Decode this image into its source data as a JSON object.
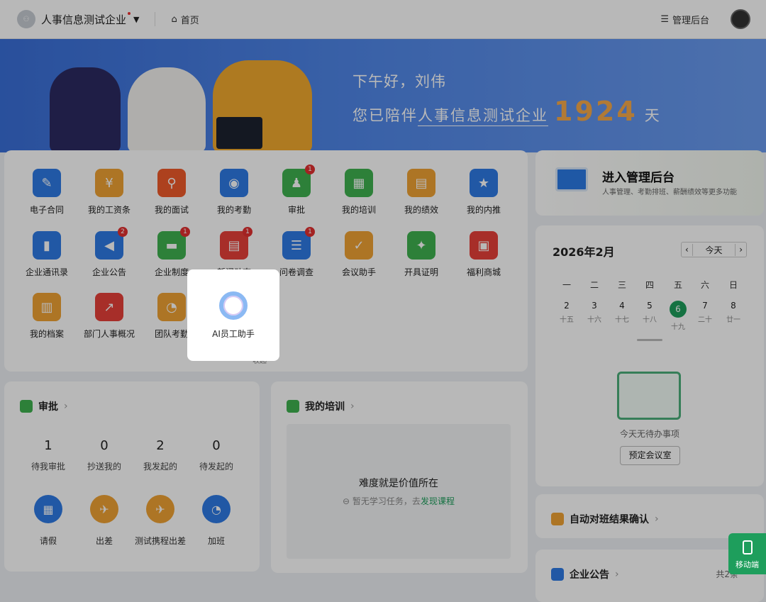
{
  "header": {
    "company": "人事信息测试企业",
    "home": "首页",
    "admin": "管理后台"
  },
  "banner": {
    "greeting": "下午好，刘伟",
    "accompany_prefix": "您已陪伴",
    "company": "人事信息测试企业",
    "days": "1924",
    "days_unit": "天"
  },
  "apps": [
    {
      "label": "电子合同",
      "color": "#2f7be5",
      "glyph": "✎"
    },
    {
      "label": "我的工资条",
      "color": "#f0a234",
      "glyph": "¥"
    },
    {
      "label": "我的面试",
      "color": "#f05a2a",
      "glyph": "⚲"
    },
    {
      "label": "我的考勤",
      "color": "#2f7be5",
      "glyph": "◉"
    },
    {
      "label": "审批",
      "color": "#3fb24f",
      "glyph": "♟",
      "badge": "1"
    },
    {
      "label": "我的培训",
      "color": "#3fb24f",
      "glyph": "▦"
    },
    {
      "label": "我的绩效",
      "color": "#f0a234",
      "glyph": "▤"
    },
    {
      "label": "我的内推",
      "color": "#2f7be5",
      "glyph": "★"
    },
    {
      "label": "企业通讯录",
      "color": "#2f7be5",
      "glyph": "▮"
    },
    {
      "label": "企业公告",
      "color": "#2f7be5",
      "glyph": "◀",
      "badge": "2"
    },
    {
      "label": "企业制度",
      "color": "#3fb24f",
      "glyph": "▬",
      "badge": "1"
    },
    {
      "label": "新闻动态",
      "color": "#e8403a",
      "glyph": "▤",
      "badge": "1"
    },
    {
      "label": "问卷调查",
      "color": "#2f7be5",
      "glyph": "☰",
      "badge": "1"
    },
    {
      "label": "会议助手",
      "color": "#f0a234",
      "glyph": "✓"
    },
    {
      "label": "开具证明",
      "color": "#3fb24f",
      "glyph": "✦"
    },
    {
      "label": "福利商城",
      "color": "#e8403a",
      "glyph": "▣"
    },
    {
      "label": "我的档案",
      "color": "#f0a234",
      "glyph": "▥"
    },
    {
      "label": "部门人事概况",
      "color": "#e8403a",
      "glyph": "↗"
    },
    {
      "label": "团队考勤",
      "color": "#f0a234",
      "glyph": "◔"
    }
  ],
  "popup": {
    "label": "AI员工助手"
  },
  "collapse": "收起",
  "mgmt": {
    "title": "进入管理后台",
    "subtitle": "人事管理、考勤排班、薪酬绩效等更多功能"
  },
  "calendar": {
    "month": "2026年2月",
    "today": "今天",
    "prev": "‹",
    "next": "›",
    "weekdays": [
      "一",
      "二",
      "三",
      "四",
      "五",
      "六",
      "日"
    ],
    "days": [
      {
        "d": "2",
        "l": "十五"
      },
      {
        "d": "3",
        "l": "十六"
      },
      {
        "d": "4",
        "l": "十七"
      },
      {
        "d": "5",
        "l": "十八"
      },
      {
        "d": "6",
        "l": "十九"
      },
      {
        "d": "7",
        "l": "二十"
      },
      {
        "d": "8",
        "l": "廿一"
      }
    ],
    "selected_index": 4,
    "empty": "今天无待办事项",
    "book": "预定会议室"
  },
  "approval": {
    "title": "审批",
    "stats": [
      {
        "value": "1",
        "label": "待我审批"
      },
      {
        "value": "0",
        "label": "抄送我的"
      },
      {
        "value": "2",
        "label": "我发起的"
      },
      {
        "value": "0",
        "label": "待发起的"
      }
    ],
    "actions": [
      {
        "label": "请假",
        "color": "#2f7be5",
        "glyph": "▦"
      },
      {
        "label": "出差",
        "color": "#f0a234",
        "glyph": "✈"
      },
      {
        "label": "测试携程出差",
        "color": "#f0a234",
        "glyph": "✈"
      },
      {
        "label": "加班",
        "color": "#2f7be5",
        "glyph": "◔"
      }
    ]
  },
  "training": {
    "title": "我的培训",
    "motto": "难度就是价值所在",
    "empty": "暂无学习任务，去",
    "link": "发现课程"
  },
  "shift": {
    "title": "自动对班结果确认"
  },
  "notice": {
    "title": "企业公告",
    "count": "共2条"
  },
  "mobile": "移动端"
}
